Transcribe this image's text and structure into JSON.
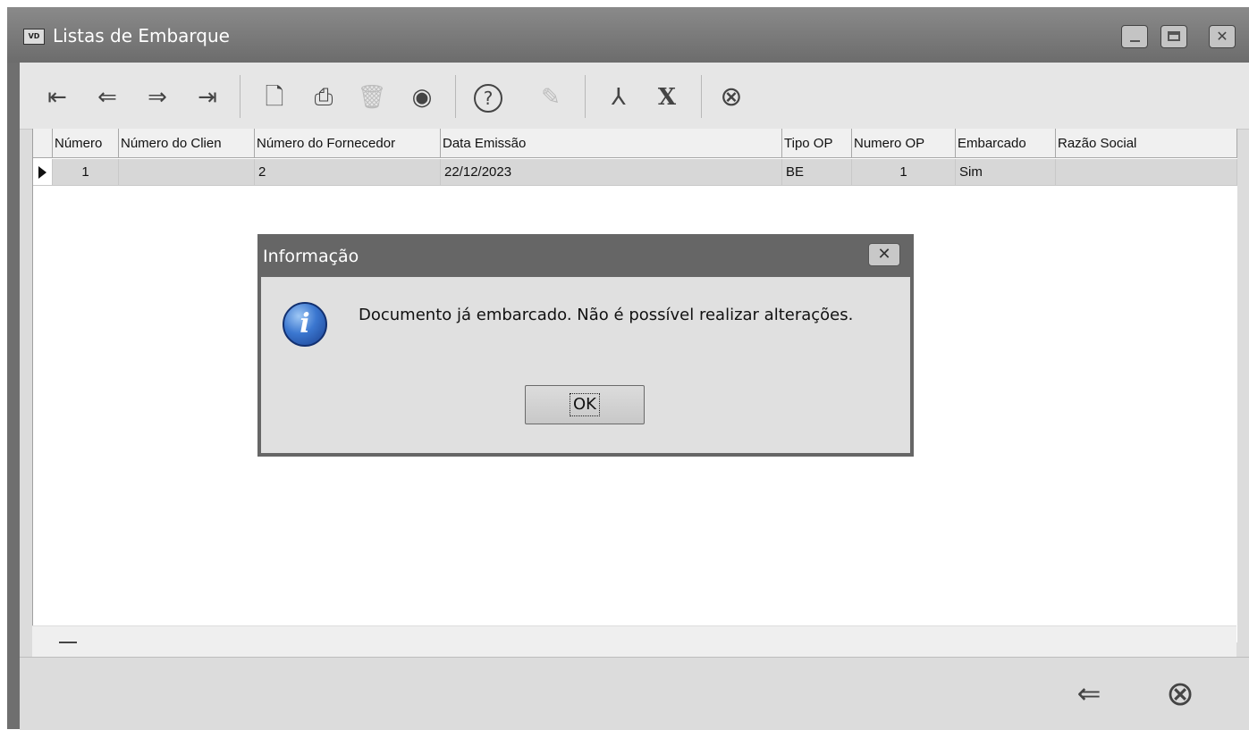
{
  "window": {
    "app_icon_text": "VD",
    "title": "Listas de Embarque"
  },
  "toolbar": {
    "buttons": [
      {
        "name": "first-record",
        "icon": "first-icon",
        "glyph": "⇤",
        "enabled": true
      },
      {
        "name": "previous-record",
        "icon": "previous-icon",
        "glyph": "⇐",
        "enabled": true
      },
      {
        "name": "next-record",
        "icon": "next-icon",
        "glyph": "⇒",
        "enabled": true
      },
      {
        "name": "last-record",
        "icon": "last-icon",
        "glyph": "⇥",
        "enabled": true
      },
      {
        "name": "new-document",
        "icon": "new-document-icon",
        "glyph": "🗋",
        "enabled": true
      },
      {
        "name": "print",
        "icon": "printer-icon",
        "glyph": "⎙",
        "enabled": true
      },
      {
        "name": "delete",
        "icon": "trash-icon",
        "glyph": "🗑",
        "enabled": false
      },
      {
        "name": "view",
        "icon": "eye-icon",
        "glyph": "◉",
        "enabled": true
      },
      {
        "name": "help",
        "icon": "help-icon",
        "glyph": "?",
        "enabled": true
      },
      {
        "name": "edit",
        "icon": "edit-icon",
        "glyph": "✎",
        "enabled": false
      },
      {
        "name": "export-pdf",
        "icon": "pdf-icon",
        "glyph": "⅄",
        "enabled": true
      },
      {
        "name": "export-excel",
        "icon": "excel-icon",
        "glyph": "X",
        "enabled": true
      },
      {
        "name": "close",
        "icon": "close-circle-icon",
        "glyph": "⊗",
        "enabled": true
      }
    ]
  },
  "grid": {
    "columns": [
      "Número",
      "Número do Clien",
      "Número do Fornecedor",
      "Data Emissão",
      "Tipo OP",
      "Numero OP",
      "Embarcado",
      "Razão Social"
    ],
    "rows": [
      [
        "1",
        "",
        "2",
        "22/12/2023",
        "BE",
        "1",
        "Sim",
        ""
      ]
    ]
  },
  "dialog": {
    "title": "Informação",
    "message": "Documento já embarcado. Não é possível realizar alterações.",
    "ok_label": "OK",
    "icon": "info-icon"
  },
  "bottom_bar": {
    "back_glyph": "⇐",
    "close_glyph": "⊗"
  }
}
